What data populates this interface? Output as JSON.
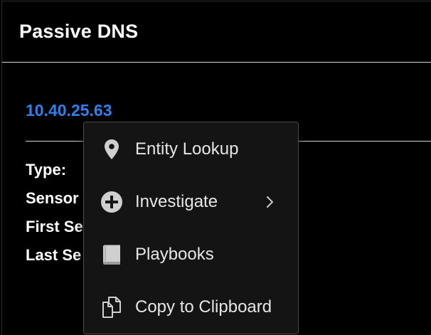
{
  "panel": {
    "title": "Passive DNS"
  },
  "entity": {
    "value": "10.40.25.63"
  },
  "details": {
    "type_label": "Type:",
    "sensor_label": "Sensor",
    "first_seen_label": "First Se",
    "last_seen_label": "Last Se"
  },
  "context_menu": {
    "items": [
      {
        "label": "Entity Lookup",
        "icon": "map-pin-icon"
      },
      {
        "label": "Investigate",
        "icon": "plus-circle-icon",
        "has_submenu": true
      },
      {
        "label": "Playbooks",
        "icon": "book-icon"
      },
      {
        "label": "Copy to Clipboard",
        "icon": "copy-icon"
      }
    ]
  },
  "colors": {
    "background": "#000000",
    "link": "#2f80ed",
    "menu_background": "#141414",
    "menu_border": "#4a4a4a",
    "icon": "#cfcfcf"
  }
}
